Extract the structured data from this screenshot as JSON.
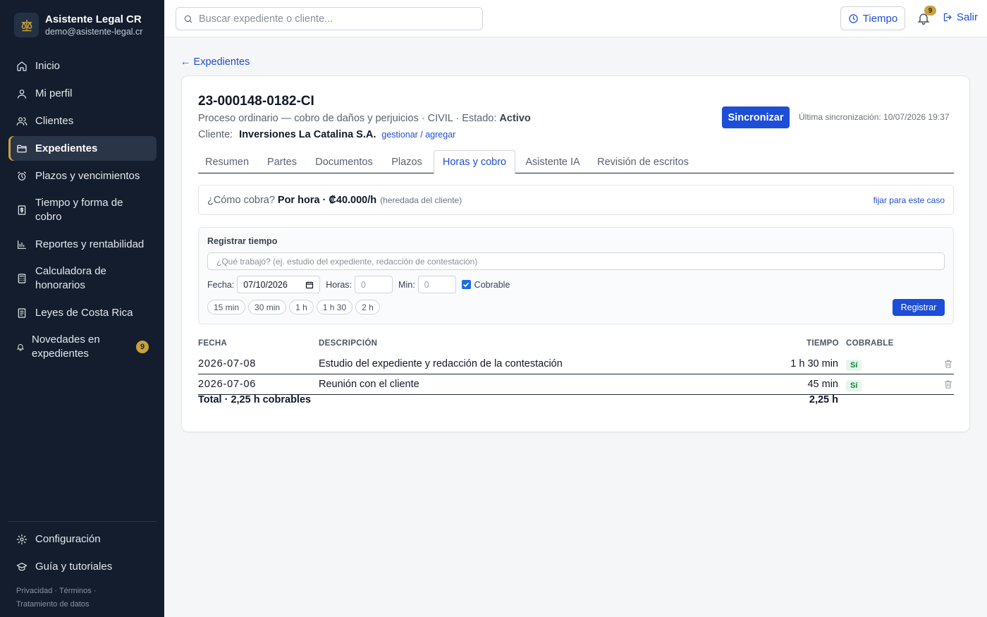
{
  "sidebar": {
    "brand_name": "Asistente Legal CR",
    "brand_email": "demo@asistente-legal.cr",
    "items": [
      {
        "label": "Inicio",
        "icon": "home-icon"
      },
      {
        "label": "Mi perfil",
        "icon": "user-icon"
      },
      {
        "label": "Clientes",
        "icon": "users-icon"
      },
      {
        "label": "Expedientes",
        "icon": "folder-icon"
      },
      {
        "label": "Plazos y vencimientos",
        "icon": "alarm-clock-icon"
      },
      {
        "label": "Tiempo y forma de cobro",
        "icon": "billing-icon"
      },
      {
        "label": "Reportes y rentabilidad",
        "icon": "bar-chart-icon"
      },
      {
        "label": "Calculadora de honorarios",
        "icon": "calculator-icon"
      },
      {
        "label": "Leyes de Costa Rica",
        "icon": "book-icon"
      },
      {
        "label": "Novedades en expedientes",
        "icon": "bell-icon",
        "badge": "9"
      }
    ],
    "bottom_items": [
      {
        "label": "Configuración",
        "icon": "gear-icon"
      },
      {
        "label": "Guía y tutoriales",
        "icon": "graduation-cap-icon"
      }
    ],
    "footer": {
      "privacy": "Privacidad",
      "terms": "Términos",
      "data": "Tratamiento de datos"
    }
  },
  "topbar": {
    "search_placeholder": "Buscar expediente o cliente...",
    "tiempo_label": "Tiempo",
    "notifications_count": "9",
    "logout_label": "Salir"
  },
  "breadcrumb": {
    "back_label": "← Expedientes"
  },
  "case": {
    "number": "23-000148-0182-CI",
    "description": "Proceso ordinario — cobro de daños y perjuicios · CIVIL · Estado: ",
    "status": "Activo",
    "client_label": "Cliente:",
    "client_name": "Inversiones La Catalina S.A.",
    "client_link": "gestionar / agregar",
    "sync_label": "Sincronizar",
    "last_sync": "Última sincronización: 10/07/2026 19:37"
  },
  "tabs": [
    "Resumen",
    "Partes",
    "Documentos",
    "Plazos",
    "Horas y cobro",
    "Asistente IA",
    "Revisión de escritos"
  ],
  "active_tab": "Horas y cobro",
  "billing": {
    "question": "¿Cómo cobra?",
    "mode": "Por hora · ₡40.000/h",
    "inherited": "(heredada del cliente)",
    "fix_link": "fijar para este caso"
  },
  "register": {
    "title": "Registrar tiempo",
    "desc_placeholder": "¿Qué trabajó? (ej. estudio del expediente, redacción de contestación)",
    "date_label": "Fecha:",
    "date_value": "07/10/2026",
    "hours_label": "Horas:",
    "hours_placeholder": "0",
    "min_label": "Min:",
    "min_placeholder": "0",
    "billable_label": "Cobrable",
    "chips": [
      "15 min",
      "30 min",
      "1 h",
      "1 h 30",
      "2 h"
    ],
    "submit_label": "Registrar"
  },
  "entries": {
    "headers": {
      "date": "FECHA",
      "description": "DESCRIPCIÓN",
      "time": "TIEMPO",
      "billable": "COBRABLE"
    },
    "rows": [
      {
        "date": "2026-07-08",
        "description": "Estudio del expediente y redacción de la contestación",
        "time": "1 h 30 min",
        "billable": "Sí"
      },
      {
        "date": "2026-07-06",
        "description": "Reunión con el cliente",
        "time": "45 min",
        "billable": "Sí"
      }
    ],
    "total_label": "Total · 2,25 h cobrables",
    "total_value": "2,25 h"
  },
  "colors": {
    "accent": "#1d4ed8",
    "sidebar_bg": "#131d2e",
    "badge": "#caa13a",
    "success": "#15803d"
  }
}
